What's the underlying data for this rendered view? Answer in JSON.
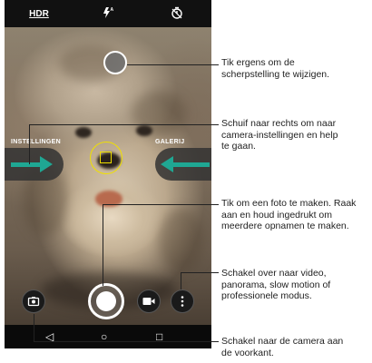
{
  "top_bar": {
    "hdr_label": "HDR",
    "flash_icon": "flash-auto-icon",
    "timer_icon": "timer-icon"
  },
  "viewfinder": {
    "left_label": "INSTELLINGEN",
    "right_label": "GALERIJ"
  },
  "controls": {
    "front_camera_icon": "switch-camera-icon",
    "shutter_icon": "shutter-icon",
    "video_icon": "video-icon",
    "more_icon": "more-vertical-icon"
  },
  "nav": {
    "back": "◁",
    "home": "○",
    "recents": "□"
  },
  "callouts": {
    "focus": "Tik ergens om de scherpstelling te wijzigen.",
    "settings": "Schuif naar rechts om naar camera-instellingen en help te gaan.",
    "photo": "Tik om een foto te maken. Raak aan en houd ingedrukt om meerdere opnamen te maken.",
    "modes": "Schakel over naar video, panorama, slow motion of professionele modus.",
    "front_camera": "Schakel naar de camera aan de voorkant."
  },
  "colors": {
    "accent_teal": "#1fa793",
    "focus_yellow": "#f0e000"
  }
}
